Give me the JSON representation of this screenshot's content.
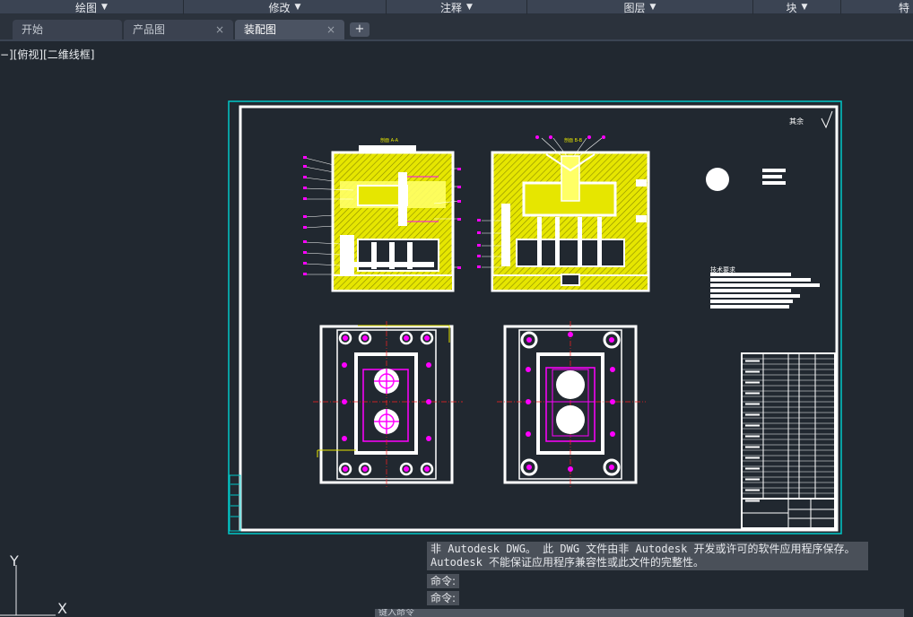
{
  "ribbon": {
    "panels": [
      {
        "label": "绘图"
      },
      {
        "label": "修改"
      },
      {
        "label": "注释"
      },
      {
        "label": "图层"
      },
      {
        "label": "块"
      },
      {
        "label": "特"
      }
    ]
  },
  "tabs": [
    {
      "label": "开始",
      "closable": false
    },
    {
      "label": "产品图",
      "closable": true
    },
    {
      "label": "装配图",
      "closable": true,
      "active": true
    }
  ],
  "tab_add_label": "+",
  "tab_close_glyph": "×",
  "viewport_label": "−][俯视][二维线框]",
  "drawing": {
    "section_labels": [
      "剖面 A-A",
      "剖面 B-B"
    ],
    "notes_title": "技术要求",
    "roughness_label": "其余"
  },
  "command": {
    "message_lines": [
      "非 Autodesk DWG。 此 DWG 文件由非 Autodesk 开发或许可的软件应用程序保存。",
      "Autodesk 不能保证应用程序兼容性或此文件的完整性。"
    ],
    "history": [
      "命令:",
      "命令:"
    ],
    "input_placeholder": "键入命令"
  },
  "ucs": {
    "x_label": "X",
    "y_label": "Y"
  },
  "colors": {
    "background": "#212830",
    "sheet_border": "#00c8c8",
    "lines": "#ffffff",
    "fill": "#e6e600",
    "accent": "#ff00ff",
    "centerline": "#ff2020"
  },
  "icons": [
    "caret-down-icon",
    "close-icon",
    "plus-icon",
    "ucs-icon",
    "roughness-icon"
  ]
}
